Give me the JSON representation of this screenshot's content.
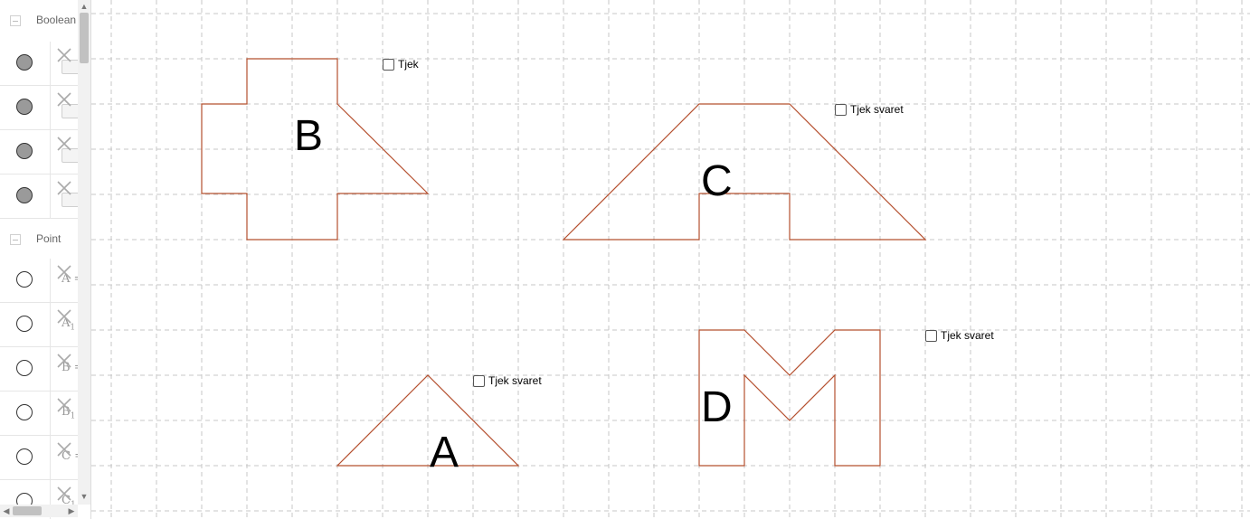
{
  "algebra": {
    "categories": [
      {
        "label": "Boolean"
      },
      {
        "label": "Point"
      }
    ],
    "boolean_rows": 4,
    "point_rows": [
      {
        "name": "A",
        "suffix": " =",
        "sub": ""
      },
      {
        "name": "A",
        "suffix": "",
        "sub": "1"
      },
      {
        "name": "B",
        "suffix": " =",
        "sub": ""
      },
      {
        "name": "B",
        "suffix": "",
        "sub": "1"
      },
      {
        "name": "C",
        "suffix": " =",
        "sub": ""
      },
      {
        "name": "C",
        "suffix": "",
        "sub": "1"
      }
    ]
  },
  "checkboxes": {
    "b": {
      "label": "Tjek"
    },
    "c": {
      "label": "Tjek svaret"
    },
    "a": {
      "label": "Tjek svaret"
    },
    "d": {
      "label": "Tjek svaret"
    }
  },
  "shapes": {
    "a": {
      "letter": "A"
    },
    "b": {
      "letter": "B"
    },
    "c": {
      "letter": "C"
    },
    "d": {
      "letter": "D"
    }
  },
  "colors": {
    "polygon_stroke": "#b5502f",
    "grid": "#c7c7c7",
    "marble_filled": "#9a9a9a"
  }
}
